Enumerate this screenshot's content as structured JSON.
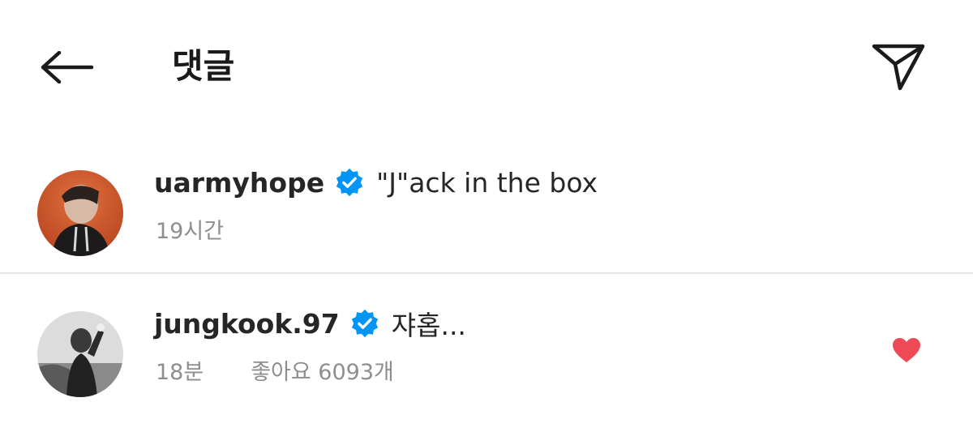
{
  "header": {
    "title": "댓글",
    "back_icon": "arrow-left-icon",
    "share_icon": "paper-plane-icon"
  },
  "comments": [
    {
      "username": "uarmyhope",
      "verified": true,
      "text": "\"J\"ack in the box",
      "time": "19시간",
      "likes": "",
      "liked": false
    },
    {
      "username": "jungkook.97",
      "verified": true,
      "text": "쟈홉...",
      "time": "18분",
      "likes": "좋아요 6093개",
      "liked": true
    }
  ],
  "colors": {
    "verified_blue": "#0095f6",
    "heart_red": "#ed4956",
    "meta_gray": "#8e8e8e",
    "text_dark": "#262626",
    "divider": "#e6e6e6"
  }
}
